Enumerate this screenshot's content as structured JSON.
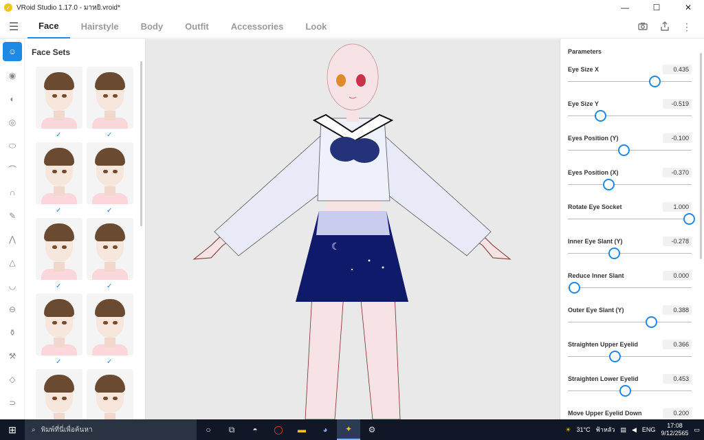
{
  "window": {
    "title": "VRoid Studio 1.17.0 - มาหยิ.vroid*",
    "minimize": "—",
    "maximize": "☐",
    "close": "✕"
  },
  "tabs": [
    {
      "label": "Face",
      "active": true
    },
    {
      "label": "Hairstyle",
      "active": false
    },
    {
      "label": "Body",
      "active": false
    },
    {
      "label": "Outfit",
      "active": false
    },
    {
      "label": "Accessories",
      "active": false
    },
    {
      "label": "Look",
      "active": false
    }
  ],
  "header_icons": [
    "camera-icon",
    "export-icon",
    "more-vert-icon"
  ],
  "rail_icons": [
    "face-icon",
    "eye-icon",
    "ear-icon",
    "eye-outline-icon",
    "oval-icon",
    "eyebrow-icon",
    "ear-shape-icon",
    "brush-icon",
    "eyelash-icon",
    "nose-icon",
    "mouth-icon",
    "lips-icon",
    "bottle-icon",
    "wrench-icon",
    "diamond-icon",
    "ear-side-icon"
  ],
  "facesets": {
    "title": "Face Sets",
    "count": 10,
    "check_glyph": "✓"
  },
  "parameters": {
    "title": "Parameters",
    "items": [
      {
        "label": "Eye Size X",
        "value": "0.435",
        "fraction": 0.7
      },
      {
        "label": "Eye Size Y",
        "value": "-0.519",
        "fraction": 0.26
      },
      {
        "label": "Eyes Position (Y)",
        "value": "-0.100",
        "fraction": 0.45
      },
      {
        "label": "Eyes Position (X)",
        "value": "-0.370",
        "fraction": 0.33
      },
      {
        "label": "Rotate Eye Socket",
        "value": "1.000",
        "fraction": 0.98
      },
      {
        "label": "Inner Eye Slant (Y)",
        "value": "-0.278",
        "fraction": 0.37
      },
      {
        "label": "Reduce Inner Slant",
        "value": "0.000",
        "fraction": 0.05
      },
      {
        "label": "Outer Eye Slant (Y)",
        "value": "0.388",
        "fraction": 0.67
      },
      {
        "label": "Straighten Upper Eyelid",
        "value": "0.366",
        "fraction": 0.38
      },
      {
        "label": "Straighten Lower Eyelid",
        "value": "0.453",
        "fraction": 0.46
      },
      {
        "label": "Move Upper Eyelid Down",
        "value": "0.200",
        "fraction": 0.23
      }
    ]
  },
  "taskbar": {
    "search_placeholder": "พิมพ์ที่นี่เพื่อค้นหา",
    "weather": "31°C",
    "weather_text": "ฟ้าหลัว",
    "lang": "ENG",
    "time": "17:08",
    "date": "9/12/2565"
  }
}
